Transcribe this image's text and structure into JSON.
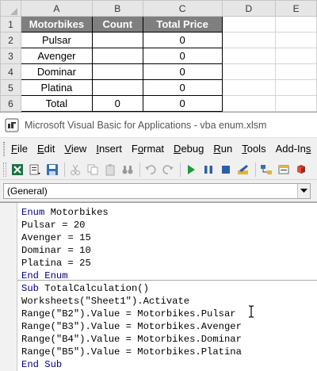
{
  "spreadsheet": {
    "columns": [
      "A",
      "B",
      "C",
      "D",
      "E"
    ],
    "rows": [
      "1",
      "2",
      "3",
      "4",
      "5",
      "6"
    ],
    "headers": [
      "Motorbikes",
      "Count",
      "Total Price"
    ],
    "data": [
      [
        "Pulsar",
        "",
        "0"
      ],
      [
        "Avenger",
        "",
        "0"
      ],
      [
        "Dominar",
        "",
        "0"
      ],
      [
        "Platina",
        "",
        "0"
      ],
      [
        "Total",
        "0",
        "0"
      ]
    ]
  },
  "vba": {
    "title": "Microsoft Visual Basic for Applications - vba enum.xlsm",
    "menu": [
      {
        "u": "F",
        "rest": "ile"
      },
      {
        "u": "E",
        "rest": "dit"
      },
      {
        "u": "V",
        "rest": "iew"
      },
      {
        "u": "I",
        "rest": "nsert"
      },
      {
        "u": "",
        "pre": "F",
        "mid": "o",
        "rest": "rmat"
      },
      {
        "u": "D",
        "rest": "ebug"
      },
      {
        "u": "R",
        "rest": "un"
      },
      {
        "u": "T",
        "rest": "ools"
      },
      {
        "u": "",
        "pre": "Add-In",
        "mid": "s",
        "rest": ""
      }
    ],
    "object_combo": "(General)",
    "code_lines": [
      [
        {
          "t": "Enum",
          "k": true
        },
        {
          "t": " Motorbikes"
        }
      ],
      [
        {
          "t": "Pulsar = 20"
        }
      ],
      [
        {
          "t": "Avenger = 15"
        }
      ],
      [
        {
          "t": "Dominar = 10"
        }
      ],
      [
        {
          "t": "Platina = 25"
        }
      ],
      [
        {
          "t": "End Enum",
          "k": true
        }
      ],
      [
        {
          "t": "Sub",
          "k": true
        },
        {
          "t": " TotalCalculation()"
        }
      ],
      [
        {
          "t": "Worksheets(\"Sheet1\").Activate"
        }
      ],
      [
        {
          "t": "Range(\"B2\").Value = Motorbikes.Pulsar"
        }
      ],
      [
        {
          "t": "Range(\"B3\").Value = Motorbikes.Avenger"
        }
      ],
      [
        {
          "t": "Range(\"B4\").Value = Motorbikes.Dominar"
        }
      ],
      [
        {
          "t": "Range(\"B5\").Value = Motorbikes.Platina"
        }
      ],
      [
        {
          "t": "End Sub",
          "k": true
        }
      ]
    ]
  }
}
